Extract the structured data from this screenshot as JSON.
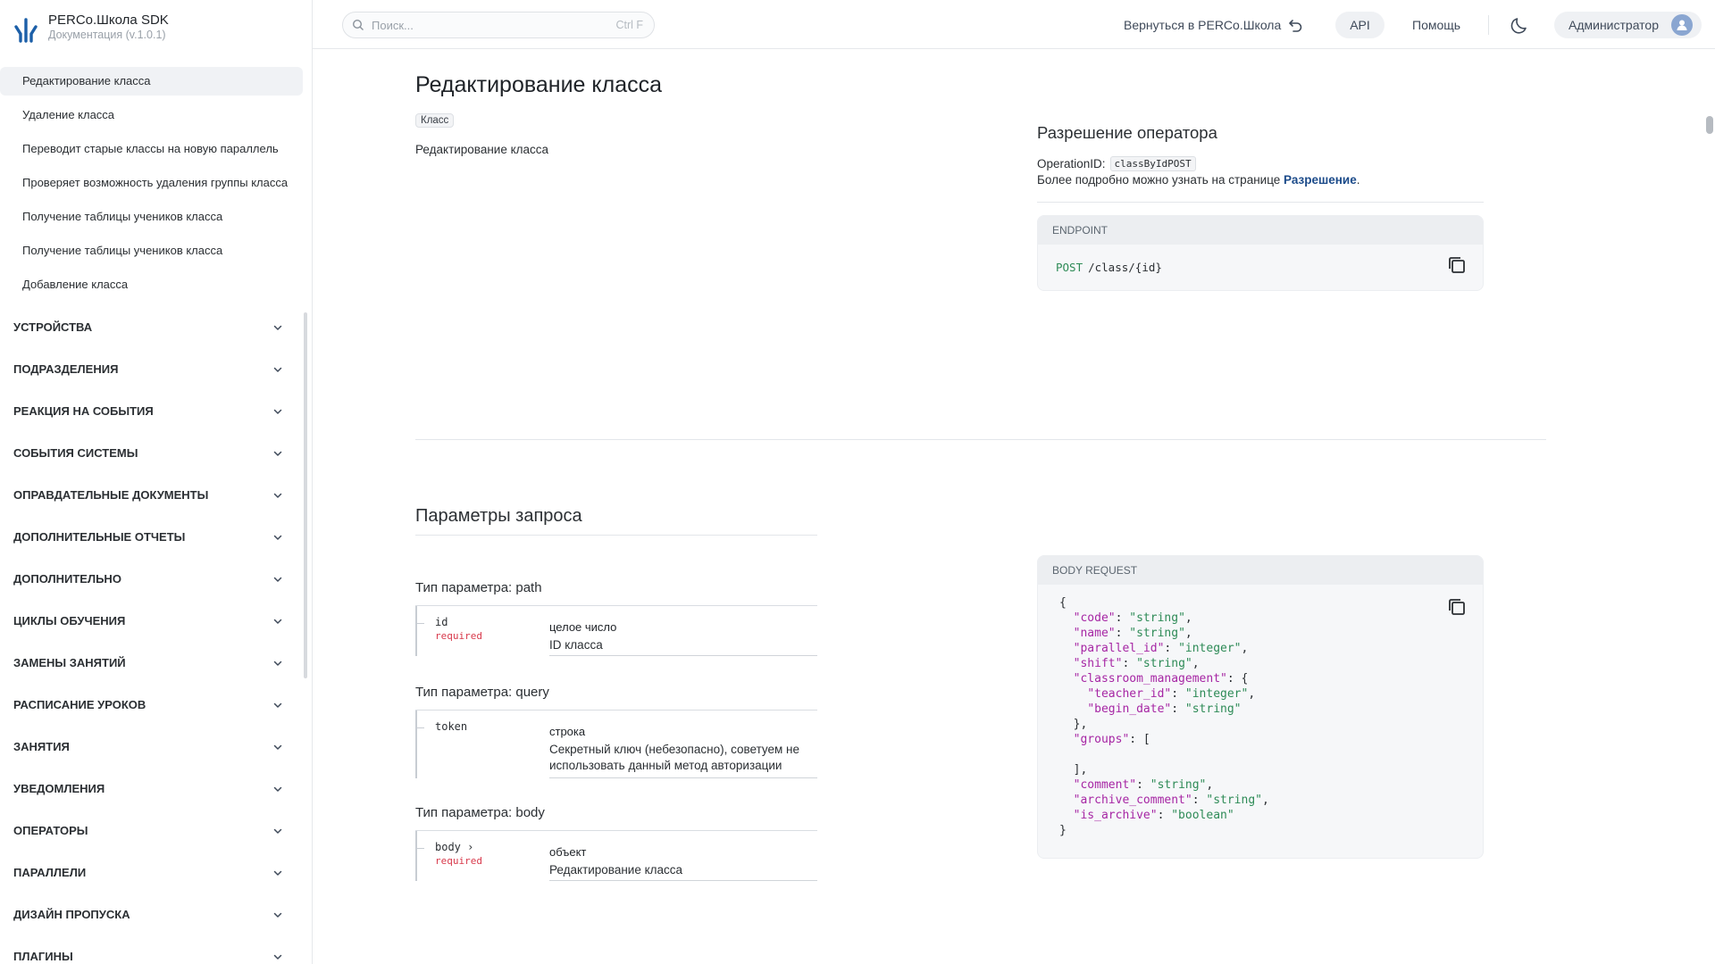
{
  "brand": {
    "title": "PERCo.Школа SDK",
    "subtitle": "Документация (v.1.0.1)"
  },
  "sidebar": {
    "items": [
      {
        "label": "Редактирование класса",
        "active": true
      },
      {
        "label": "Удаление класса"
      },
      {
        "label": "Переводит старые классы на новую параллель"
      },
      {
        "label": "Проверяет возможность удаления группы класса"
      },
      {
        "label": "Получение таблицы учеников класса"
      },
      {
        "label": "Получение таблицы учеников класса"
      },
      {
        "label": "Добавление класса"
      }
    ],
    "groups": [
      "УСТРОЙСТВА",
      "ПОДРАЗДЕЛЕНИЯ",
      "РЕАКЦИЯ НА СОБЫТИЯ",
      "СОБЫТИЯ СИСТЕМЫ",
      "ОПРАВДАТЕЛЬНЫЕ ДОКУМЕНТЫ",
      "ДОПОЛНИТЕЛЬНЫЕ ОТЧЕТЫ",
      "ДОПОЛНИТЕЛЬНО",
      "ЦИКЛЫ ОБУЧЕНИЯ",
      "ЗАМЕНЫ ЗАНЯТИЙ",
      "РАСПИСАНИЕ УРОКОВ",
      "ЗАНЯТИЯ",
      "УВЕДОМЛЕНИЯ",
      "ОПЕРАТОРЫ",
      "ПАРАЛЛЕЛИ",
      "ДИЗАЙН ПРОПУСКА",
      "ПЛАГИНЫ"
    ]
  },
  "topbar": {
    "search_placeholder": "Поиск...",
    "search_shortcut": "Ctrl F",
    "back_label": "Вернуться в PERCo.Школа",
    "api_label": "API",
    "help_label": "Помощь",
    "user_label": "Администратор"
  },
  "page": {
    "title": "Редактирование класса",
    "tag": "Класс",
    "description": "Редактирование класса"
  },
  "permission": {
    "title": "Разрешение оператора",
    "operation_label": "OperationID:",
    "operation_id": "classByIdPOST",
    "more_text": "Более подробно можно узнать на странице ",
    "more_link": "Разрешение",
    "more_suffix": "."
  },
  "endpoint": {
    "header": "ENDPOINT",
    "method": "POST",
    "path": "/class/{id}"
  },
  "params": {
    "title": "Параметры запроса",
    "sections": [
      {
        "type_label": "Тип параметра: path",
        "name": "id",
        "required": "required",
        "type": "целое число",
        "description": "ID класса"
      },
      {
        "type_label": "Тип параметра: query",
        "name": "token",
        "required": "",
        "type": "строка",
        "description": "Секретный ключ (небезопасно), советуем не использовать данный метод авторизации"
      },
      {
        "type_label": "Тип параметра: body",
        "name": "body ›",
        "required": "required",
        "type": "объект",
        "description": "Редактирование класса"
      }
    ]
  },
  "body_request": {
    "header": "BODY REQUEST",
    "lines": [
      {
        "indent": "",
        "text": "{"
      },
      {
        "indent": "  ",
        "key": "\"code\"",
        "value": "\"string\"",
        "end": ","
      },
      {
        "indent": "  ",
        "key": "\"name\"",
        "value": "\"string\"",
        "end": ","
      },
      {
        "indent": "  ",
        "key": "\"parallel_id\"",
        "value": "\"integer\"",
        "end": ","
      },
      {
        "indent": "  ",
        "key": "\"shift\"",
        "value": "\"string\"",
        "end": ","
      },
      {
        "indent": "  ",
        "key": "\"classroom_management\"",
        "value": "",
        "end": ": {"
      },
      {
        "indent": "    ",
        "key": "\"teacher_id\"",
        "value": "\"integer\"",
        "end": ","
      },
      {
        "indent": "    ",
        "key": "\"begin_date\"",
        "value": "\"string\"",
        "end": ""
      },
      {
        "indent": "  ",
        "text": "},"
      },
      {
        "indent": "  ",
        "key": "\"groups\"",
        "value": "",
        "end": ": ["
      },
      {
        "indent": "",
        "text": ""
      },
      {
        "indent": "  ",
        "text": "],"
      },
      {
        "indent": "  ",
        "key": "\"comment\"",
        "value": "\"string\"",
        "end": ","
      },
      {
        "indent": "  ",
        "key": "\"archive_comment\"",
        "value": "\"string\"",
        "end": ","
      },
      {
        "indent": "  ",
        "key": "\"is_archive\"",
        "value": "\"boolean\"",
        "end": ""
      },
      {
        "indent": "",
        "text": "}"
      }
    ]
  },
  "colors": {
    "accent": "#1c4b8a",
    "required": "#d8394b",
    "string": "#2e8b57",
    "key": "#a626a4"
  }
}
